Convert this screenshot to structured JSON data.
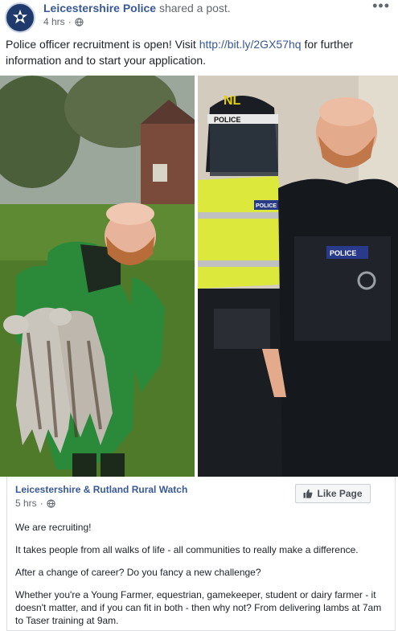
{
  "post": {
    "page_name": "Leicestershire Police",
    "action": " shared a post.",
    "time": "4 hrs",
    "text_before_link": "Police officer recruitment is open! Visit ",
    "link": "http://bit.ly/2GX57hq",
    "text_after_link": " for further information and to start your application.",
    "more_label": "•••"
  },
  "photos": {
    "right_helmet_text": "NL",
    "helmet_band_text": "POLICE",
    "vest_text": "POLICE",
    "badge_text": "POLICE"
  },
  "shared": {
    "page_name": "Leicestershire & Rutland Rural Watch",
    "time": "5 hrs",
    "like_label": "Like Page",
    "paragraphs": [
      "We are recruiting!",
      "It takes people from all walks of life - all communities to really make a difference.",
      "After a change of career? Do you fancy a new challenge?",
      "Whether you're a Young Farmer, equestrian, gamekeeper, student or dairy farmer - it doesn't matter, and if you can fit in both - then why not? From delivering lambs at 7am to Taser training at 9am."
    ]
  },
  "colors": {
    "link": "#385898",
    "meta": "#606770",
    "text": "#1d2129"
  },
  "icons": {
    "avatar": "police-crest-icon",
    "globe": "globe-icon",
    "like": "thumbs-up-icon"
  }
}
